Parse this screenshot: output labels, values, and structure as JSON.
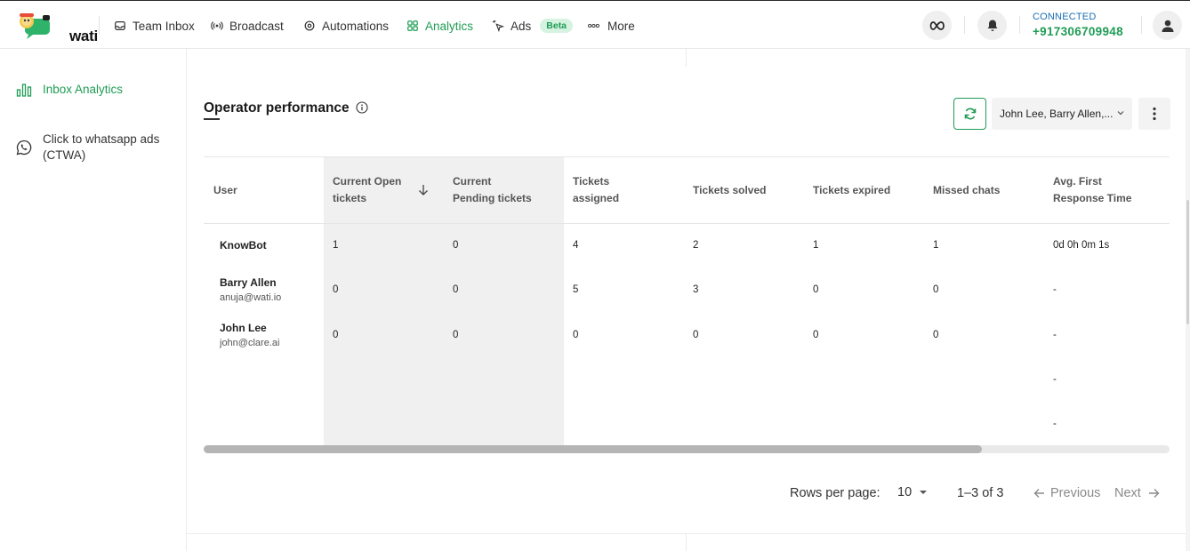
{
  "brand": {
    "name": "wati"
  },
  "nav": {
    "items": [
      {
        "label": "Team Inbox",
        "icon": "inbox-icon"
      },
      {
        "label": "Broadcast",
        "icon": "broadcast-icon"
      },
      {
        "label": "Automations",
        "icon": "automations-icon"
      },
      {
        "label": "Analytics",
        "icon": "analytics-icon",
        "active": true
      },
      {
        "label": "Ads",
        "icon": "ads-cursor-icon",
        "badge": "Beta"
      },
      {
        "label": "More",
        "icon": "more-dots-icon"
      }
    ],
    "connection_status": "CONNECTED",
    "phone": "+917306709948"
  },
  "sidebar": {
    "items": [
      {
        "label": "Inbox Analytics",
        "icon": "bar-chart-icon",
        "active": true
      },
      {
        "label_line1": "Click to whatsapp ads",
        "label_line2": "(CTWA)",
        "icon": "whatsapp-icon"
      }
    ]
  },
  "section": {
    "title": "Operator performance",
    "user_filter": "John Lee, Barry Allen,..."
  },
  "table": {
    "columns": [
      {
        "line1": "User",
        "line2": ""
      },
      {
        "line1": "Current Open",
        "line2": "tickets"
      },
      {
        "line1": "Current",
        "line2": "Pending tickets"
      },
      {
        "line1": "Tickets",
        "line2": "assigned"
      },
      {
        "line1": "Tickets solved",
        "line2": ""
      },
      {
        "line1": "Tickets expired",
        "line2": ""
      },
      {
        "line1": "Missed chats",
        "line2": ""
      },
      {
        "line1": "Avg. First",
        "line2": "Response Time"
      }
    ],
    "rows": [
      {
        "name": "KnowBot",
        "email": "",
        "open": "1",
        "pending": "0",
        "assigned": "4",
        "solved": "2",
        "expired": "1",
        "missed": "1",
        "avg_response": "0d 0h 0m 1s"
      },
      {
        "name": "Barry Allen",
        "email": "anuja@wati.io",
        "open": "0",
        "pending": "0",
        "assigned": "5",
        "solved": "3",
        "expired": "0",
        "missed": "0",
        "avg_response": "-"
      },
      {
        "name": "John Lee",
        "email": "john@clare.ai",
        "open": "0",
        "pending": "0",
        "assigned": "0",
        "solved": "0",
        "expired": "0",
        "missed": "0",
        "avg_response": "-"
      }
    ],
    "extra_dashes": [
      "-",
      "-"
    ]
  },
  "pagination": {
    "rows_per_page_label": "Rows per page:",
    "rows_per_page": "10",
    "range": "1–3 of 3",
    "previous": "Previous",
    "next": "Next"
  },
  "colors": {
    "accent": "#1f9c55",
    "connected": "#1a6fb3"
  }
}
